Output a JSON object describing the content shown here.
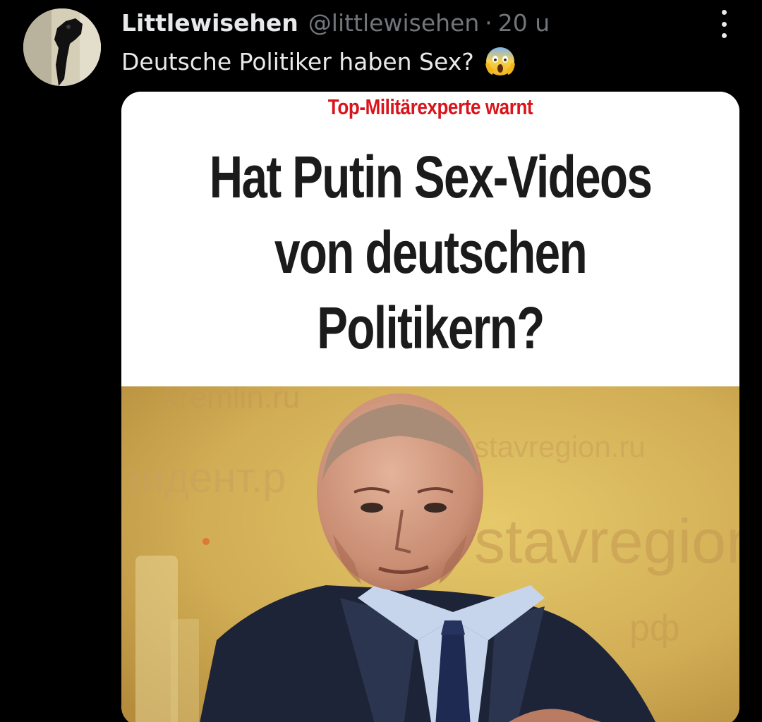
{
  "post": {
    "display_name": "Littlewisehen",
    "handle": "@littlewisehen",
    "separator": "·",
    "timestamp": "20 u",
    "text": "Deutsche Politiker haben Sex?",
    "emoji": "face-screaming-in-fear",
    "more_icon": "three-dots-vertical-icon"
  },
  "media": {
    "kicker": "Top-Militärexperte warnt",
    "headline_lines": [
      "Hat Putin Sex-Videos",
      "von deutschen",
      "Politikern?"
    ],
    "kicker_color": "#d9141b",
    "photo_description": "man in dark suit in front of yellow backdrop",
    "backdrop_text": [
      "kremlin.ru",
      "зидент.р",
      "stavregion.ru",
      "stavregion",
      "рф"
    ]
  },
  "colors": {
    "background": "#000000",
    "primary_text": "#e7e9ea",
    "secondary_text": "#71767b"
  }
}
